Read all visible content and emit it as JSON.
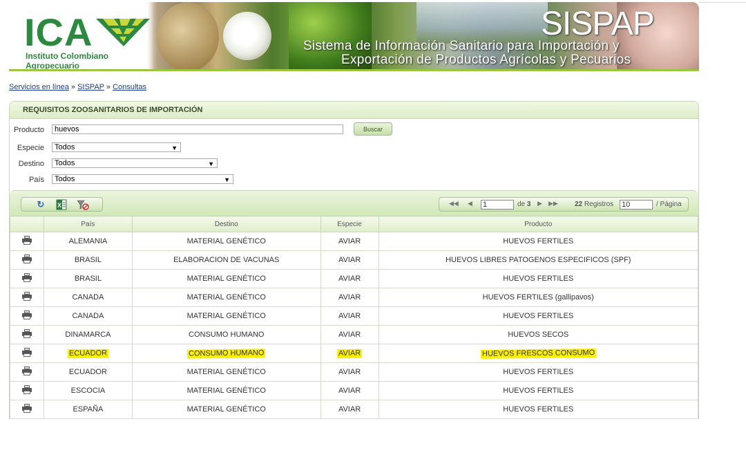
{
  "banner": {
    "logo_text": "ICA",
    "logo_subtitle": "Instituto Colombiano Agropecuario",
    "title": "SISPAP",
    "subtitle_line1": "Sistema de Información Sanitario para Importación y",
    "subtitle_line2": "Exportación de Productos Agrícolas y Pecuarios"
  },
  "breadcrumb": {
    "items": [
      "Servicios en línea",
      "SISPAP",
      "Consultas"
    ],
    "separator": "»"
  },
  "panel": {
    "title": "REQUISITOS ZOOSANITARIOS DE IMPORTACIÓN"
  },
  "form": {
    "producto_label": "Producto",
    "producto_value": "huevos",
    "buscar_label": "Buscar",
    "especie_label": "Especie",
    "especie_value": "Todos",
    "destino_label": "Destino",
    "destino_value": "Todos",
    "pais_label": "País",
    "pais_value": "Todos"
  },
  "toolbar": {
    "icons": [
      "refresh-icon",
      "excel-icon",
      "clear-filter-icon"
    ]
  },
  "pager": {
    "page": "1",
    "of_label": "de",
    "total_pages": "3",
    "records_count": "22",
    "records_label": "Registros",
    "page_size": "10",
    "per_page_label": "/ Página"
  },
  "table": {
    "headers": [
      "",
      "País",
      "Destino",
      "Especie",
      "Producto"
    ],
    "rows": [
      {
        "pais": "ALEMANIA",
        "destino": "MATERIAL GENÉTICO",
        "especie": "AVIAR",
        "producto": "HUEVOS FERTILES"
      },
      {
        "pais": "BRASIL",
        "destino": "ELABORACION DE VACUNAS",
        "especie": "AVIAR",
        "producto": "HUEVOS LIBRES PATOGENOS ESPECIFICOS (SPF)"
      },
      {
        "pais": "BRASIL",
        "destino": "MATERIAL GENÉTICO",
        "especie": "AVIAR",
        "producto": "HUEVOS FERTILES"
      },
      {
        "pais": "CANADA",
        "destino": "MATERIAL GENÉTICO",
        "especie": "AVIAR",
        "producto": "HUEVOS FERTILES (gallipavos)"
      },
      {
        "pais": "CANADA",
        "destino": "MATERIAL GENÉTICO",
        "especie": "AVIAR",
        "producto": "HUEVOS FERTILES"
      },
      {
        "pais": "DINAMARCA",
        "destino": "CONSUMO HUMANO",
        "especie": "AVIAR",
        "producto": "HUEVOS SECOS"
      },
      {
        "pais": "ECUADOR",
        "destino": "CONSUMO HUMANO",
        "especie": "AVIAR",
        "producto": "HUEVOS FRESCOS CONSUMO",
        "highlighted": true
      },
      {
        "pais": "ECUADOR",
        "destino": "MATERIAL GENÉTICO",
        "especie": "AVIAR",
        "producto": "HUEVOS FERTILES"
      },
      {
        "pais": "ESCOCIA",
        "destino": "MATERIAL GENÉTICO",
        "especie": "AVIAR",
        "producto": "HUEVOS FERTILES"
      },
      {
        "pais": "ESPAÑA",
        "destino": "MATERIAL GENÉTICO",
        "especie": "AVIAR",
        "producto": "HUEVOS FERTILES"
      }
    ]
  },
  "colors": {
    "brand_green": "#2b8a3e",
    "highlight": "#fbf000",
    "link": "#1a3c8c"
  }
}
